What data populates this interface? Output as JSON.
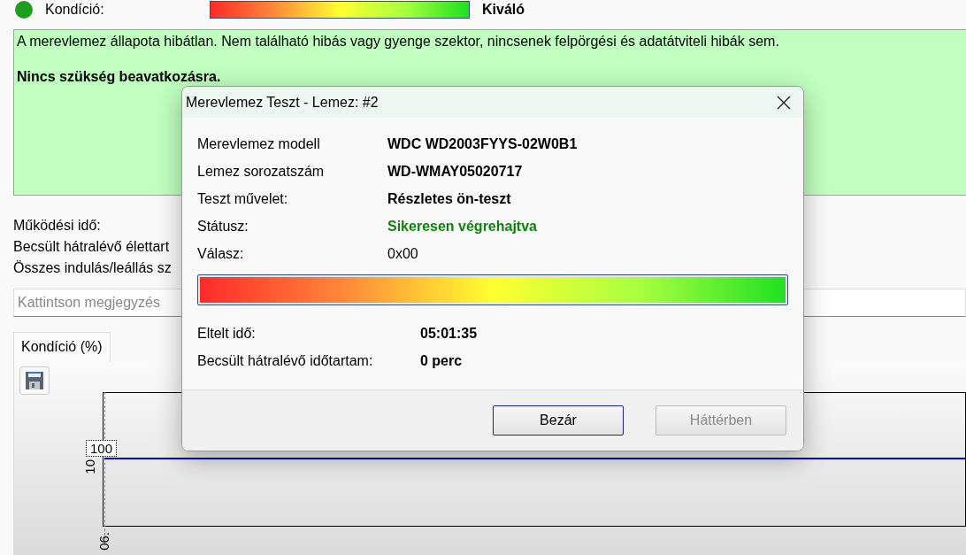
{
  "condition_row": {
    "label": "Kondíció:",
    "color": "#1e9e1e",
    "level": 1,
    "value": "Kiváló"
  },
  "status_box": {
    "message": "A merevlemez állapota hibátlan. Nem található hibás vagy gyenge szektor, nincsenek felpörgési és adatátviteli hibák sem.",
    "advice": "Nincs szükség beavatkozásra."
  },
  "info_lines": [
    "Működési idő:",
    "Becsült hátralévő élettart",
    "Összes indulás/leállás sz"
  ],
  "note_field": {
    "placeholder": "Kattintson megjegyzés"
  },
  "tabs": [
    {
      "label": "Kondíció  (%)",
      "selected": true
    }
  ],
  "chart": {
    "tooltip": "100",
    "y_axis_label": "10",
    "x_axis_label": "06."
  },
  "dialog": {
    "title": "Merevlemez Teszt - Lemez: #2",
    "fields": [
      {
        "label": "Merevlemez modell",
        "value": "WDC WD2003FYYS-02W0B1",
        "kind": "bold"
      },
      {
        "label": "Lemez sorozatszám",
        "value": "WD-WMAY05020717",
        "kind": "bold"
      },
      {
        "label": "Teszt művelet:",
        "value": "Részletes ön-teszt",
        "kind": "bold"
      },
      {
        "label": "Státusz:",
        "value": "Sikeresen végrehajtva",
        "kind": "status"
      },
      {
        "label": "Válasz:",
        "value": "0x00",
        "kind": "plain"
      }
    ],
    "progress": {
      "level": 1
    },
    "timing": [
      {
        "label": "Eltelt idő:",
        "value": "05:01:35"
      },
      {
        "label": "Becsült hátralévő időtartam:",
        "value": "0 perc"
      }
    ],
    "buttons": [
      {
        "label": "Bezár",
        "disabled": false,
        "focused": true
      },
      {
        "label": "Háttérben",
        "disabled": true,
        "focused": false
      }
    ]
  }
}
